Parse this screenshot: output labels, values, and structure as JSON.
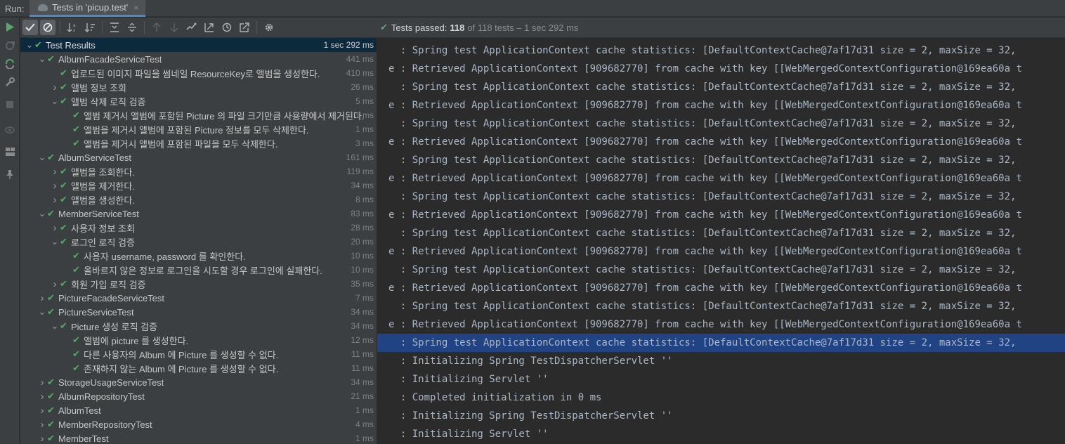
{
  "runbar": {
    "label": "Run:",
    "tab_title": "Tests in 'picup.test'",
    "close": "×"
  },
  "status": {
    "prefix": "Tests passed:",
    "passed": "118",
    "suffix": "of 118 tests – 1 sec 292 ms"
  },
  "tree": [
    {
      "name": "Test Results",
      "time": "1 sec 292 ms",
      "indent": 0,
      "arrow": "down",
      "selected": true
    },
    {
      "name": "AlbumFacadeServiceTest",
      "time": "441 ms",
      "indent": 1,
      "arrow": "down"
    },
    {
      "name": "업로드된 이미지 파일을 썸네일 ResourceKey로 앨범을 생성한다.",
      "time": "410 ms",
      "indent": 2,
      "arrow": "none"
    },
    {
      "name": "앨범 정보 조회",
      "time": "26 ms",
      "indent": 2,
      "arrow": "right"
    },
    {
      "name": "앨범 삭제 로직 검증",
      "time": "5 ms",
      "indent": 2,
      "arrow": "down"
    },
    {
      "name": "앨범 제거시 앨범에 포함된 Picture 의 파일 크기만큼 사용량에서 제거된다.",
      "time": "1 ms",
      "indent": 3,
      "arrow": "none"
    },
    {
      "name": "앨범을 제거시 앨범에 포함된 Picture 정보를 모두 삭제한다.",
      "time": "1 ms",
      "indent": 3,
      "arrow": "none"
    },
    {
      "name": "앨범을 제거시 앨범에 포함된 파일을 모두 삭제한다.",
      "time": "3 ms",
      "indent": 3,
      "arrow": "none"
    },
    {
      "name": "AlbumServiceTest",
      "time": "161 ms",
      "indent": 1,
      "arrow": "down"
    },
    {
      "name": "앨범을 조회한다.",
      "time": "119 ms",
      "indent": 2,
      "arrow": "right"
    },
    {
      "name": "앨범을 제거한다.",
      "time": "34 ms",
      "indent": 2,
      "arrow": "right"
    },
    {
      "name": "앨범을 생성한다.",
      "time": "8 ms",
      "indent": 2,
      "arrow": "right"
    },
    {
      "name": "MemberServiceTest",
      "time": "83 ms",
      "indent": 1,
      "arrow": "down"
    },
    {
      "name": "사용자 정보 조회",
      "time": "28 ms",
      "indent": 2,
      "arrow": "right"
    },
    {
      "name": "로그인 로직 검증",
      "time": "20 ms",
      "indent": 2,
      "arrow": "down"
    },
    {
      "name": "사용자 username, password 를 확인한다.",
      "time": "10 ms",
      "indent": 3,
      "arrow": "none"
    },
    {
      "name": "올바르지 않은 정보로 로그인을 시도할 경우 로그인에 실패한다.",
      "time": "10 ms",
      "indent": 3,
      "arrow": "none"
    },
    {
      "name": "회원 가입 로직 검증",
      "time": "35 ms",
      "indent": 2,
      "arrow": "right"
    },
    {
      "name": "PictureFacadeServiceTest",
      "time": "7 ms",
      "indent": 1,
      "arrow": "right"
    },
    {
      "name": "PictureServiceTest",
      "time": "34 ms",
      "indent": 1,
      "arrow": "down"
    },
    {
      "name": "Picture 생성 로직 검증",
      "time": "34 ms",
      "indent": 2,
      "arrow": "down"
    },
    {
      "name": "앨범에 picture 를 생성한다.",
      "time": "12 ms",
      "indent": 3,
      "arrow": "none"
    },
    {
      "name": "다른 사용자의 Album 에 Picture 를 생성할 수 없다.",
      "time": "11 ms",
      "indent": 3,
      "arrow": "none"
    },
    {
      "name": "존재하지 않는 Album 에 Picture 를 생성할 수 없다.",
      "time": "11 ms",
      "indent": 3,
      "arrow": "none"
    },
    {
      "name": "StorageUsageServiceTest",
      "time": "34 ms",
      "indent": 1,
      "arrow": "right"
    },
    {
      "name": "AlbumRepositoryTest",
      "time": "21 ms",
      "indent": 1,
      "arrow": "right"
    },
    {
      "name": "AlbumTest",
      "time": "1 ms",
      "indent": 1,
      "arrow": "right"
    },
    {
      "name": "MemberRepositoryTest",
      "time": "4 ms",
      "indent": 1,
      "arrow": "right"
    },
    {
      "name": "MemberTest",
      "time": "1 ms",
      "indent": 1,
      "arrow": "right"
    }
  ],
  "console": [
    {
      "text": "  : Spring test ApplicationContext cache statistics: [DefaultContextCache@7af17d31 size = 2, maxSize = 32,"
    },
    {
      "text": "e : Retrieved ApplicationContext [909682770] from cache with key [[WebMergedContextConfiguration@169ea60a t"
    },
    {
      "text": "  : Spring test ApplicationContext cache statistics: [DefaultContextCache@7af17d31 size = 2, maxSize = 32,"
    },
    {
      "text": "e : Retrieved ApplicationContext [909682770] from cache with key [[WebMergedContextConfiguration@169ea60a t"
    },
    {
      "text": "  : Spring test ApplicationContext cache statistics: [DefaultContextCache@7af17d31 size = 2, maxSize = 32,"
    },
    {
      "text": "e : Retrieved ApplicationContext [909682770] from cache with key [[WebMergedContextConfiguration@169ea60a t"
    },
    {
      "text": "  : Spring test ApplicationContext cache statistics: [DefaultContextCache@7af17d31 size = 2, maxSize = 32,"
    },
    {
      "text": "e : Retrieved ApplicationContext [909682770] from cache with key [[WebMergedContextConfiguration@169ea60a t"
    },
    {
      "text": "  : Spring test ApplicationContext cache statistics: [DefaultContextCache@7af17d31 size = 2, maxSize = 32,"
    },
    {
      "text": "e : Retrieved ApplicationContext [909682770] from cache with key [[WebMergedContextConfiguration@169ea60a t"
    },
    {
      "text": "  : Spring test ApplicationContext cache statistics: [DefaultContextCache@7af17d31 size = 2, maxSize = 32,"
    },
    {
      "text": "e : Retrieved ApplicationContext [909682770] from cache with key [[WebMergedContextConfiguration@169ea60a t"
    },
    {
      "text": "  : Spring test ApplicationContext cache statistics: [DefaultContextCache@7af17d31 size = 2, maxSize = 32,"
    },
    {
      "text": "e : Retrieved ApplicationContext [909682770] from cache with key [[WebMergedContextConfiguration@169ea60a t"
    },
    {
      "text": "  : Spring test ApplicationContext cache statistics: [DefaultContextCache@7af17d31 size = 2, maxSize = 32,"
    },
    {
      "text": "e : Retrieved ApplicationContext [909682770] from cache with key [[WebMergedContextConfiguration@169ea60a t"
    },
    {
      "text": "  : Spring test ApplicationContext cache statistics: [DefaultContextCache@7af17d31 size = 2, maxSize = 32,",
      "highlight": true
    },
    {
      "text": "  : Initializing Spring TestDispatcherServlet ''"
    },
    {
      "text": "  : Initializing Servlet ''"
    },
    {
      "text": "  : Completed initialization in 0 ms"
    },
    {
      "text": "  : Initializing Spring TestDispatcherServlet ''"
    },
    {
      "text": "  : Initializing Servlet ''"
    }
  ],
  "colors": {
    "pass": "#59a869",
    "selection": "#0d293e",
    "console_highlight": "#214283",
    "accent": "#4a88c7"
  },
  "icons": {
    "toolbar": [
      "show-passed-icon",
      "show-ignored-icon",
      "sort-alpha-icon",
      "sort-duration-icon",
      "expand-all-icon",
      "collapse-all-icon",
      "prev-failed-icon",
      "next-failed-icon",
      "import-tests-icon",
      "export-tests-icon",
      "history-icon",
      "open-external-icon",
      "settings-icon"
    ],
    "sidebar": [
      "rerun-icon",
      "rerun-failed-icon",
      "toggle-auto-test-icon",
      "wrench-icon",
      "stop-icon",
      "eye-icon",
      "layout-icon",
      "pin-icon"
    ]
  }
}
